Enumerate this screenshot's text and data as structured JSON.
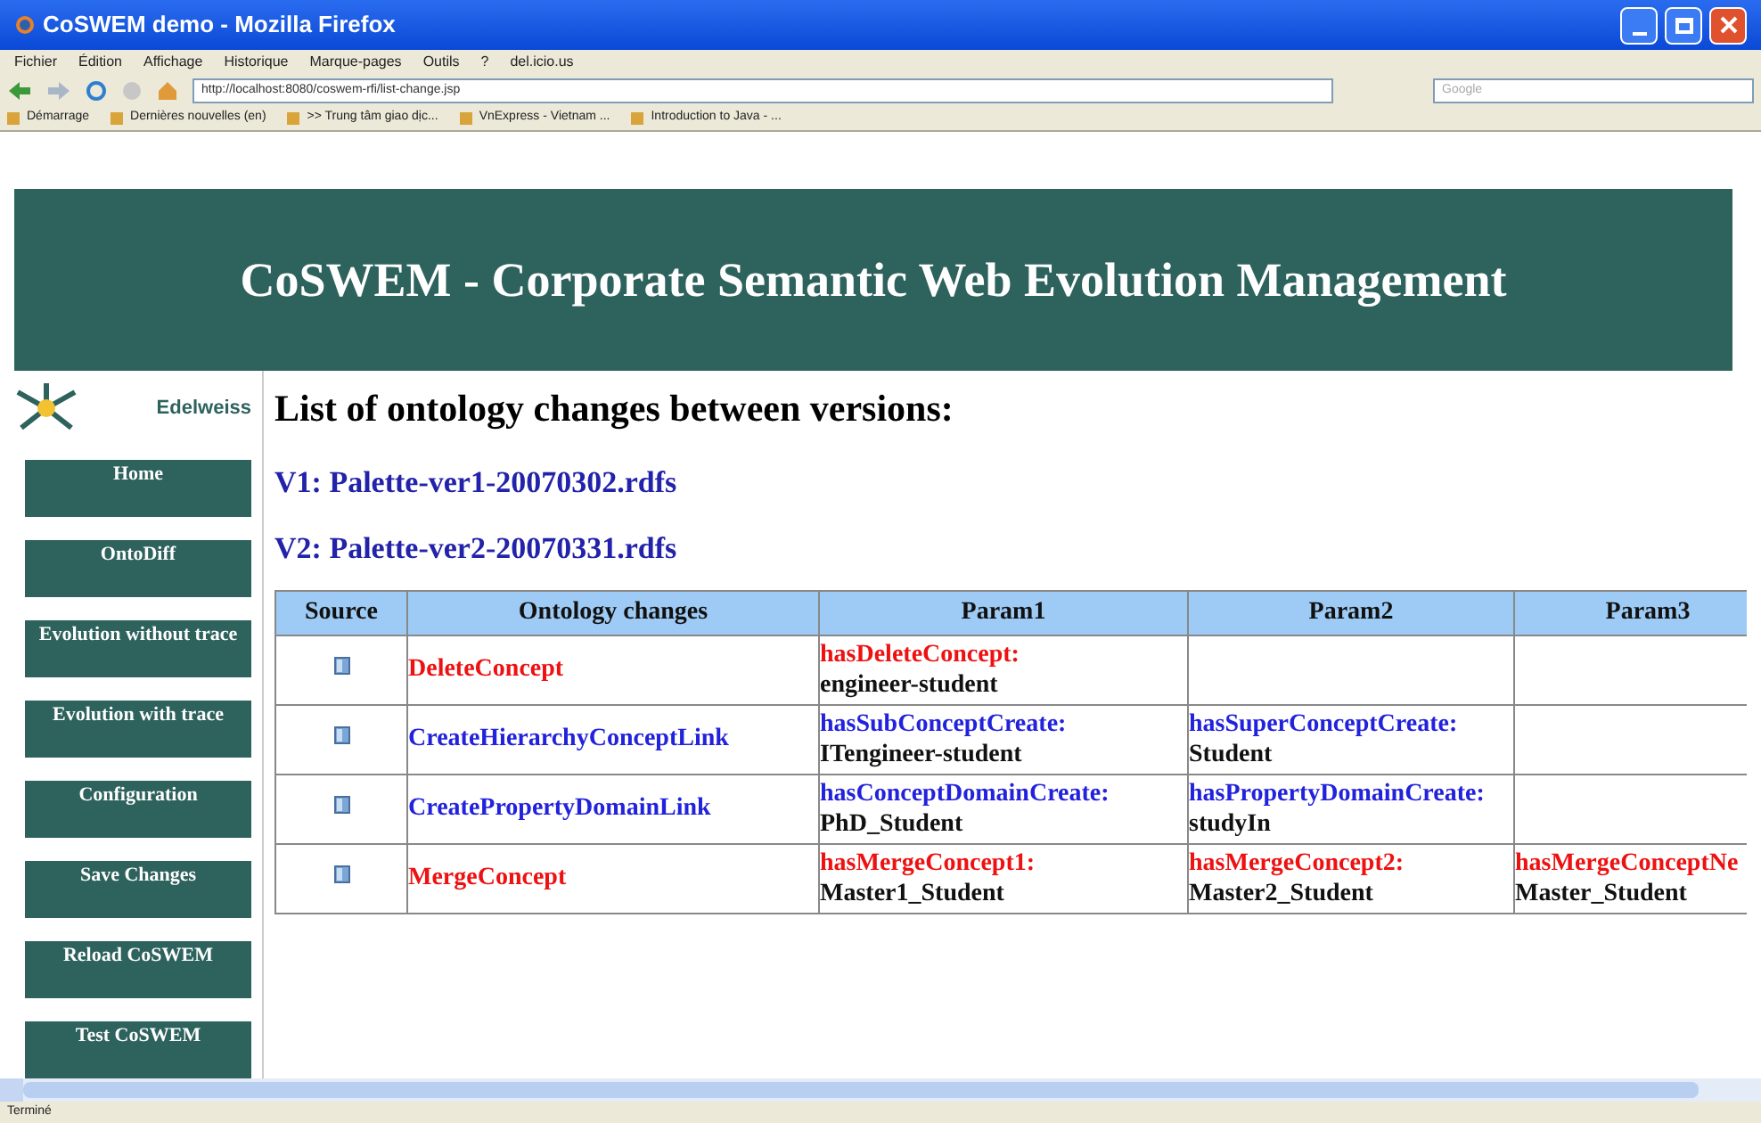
{
  "window": {
    "title": "CoSWEM demo - Mozilla Firefox"
  },
  "menu": [
    "Fichier",
    "Édition",
    "Affichage",
    "Historique",
    "Marque-pages",
    "Outils",
    "?",
    "del.icio.us"
  ],
  "address": {
    "value": "http://localhost:8080/coswem-rfi/list-change.jsp"
  },
  "search": {
    "placeholder": "Google"
  },
  "bookmarks": [
    "Démarrage",
    "Dernières nouvelles (en)",
    ">> Trung tâm giao dịc...",
    "VnExpress - Vietnam ...",
    "Introduction to Java - ..."
  ],
  "banner": {
    "title": "CoSWEM - Corporate Semantic Web Evolution Management"
  },
  "sidebar": {
    "logo_text": "Edelweiss",
    "items": [
      "Home",
      "OntoDiff",
      "Evolution without trace",
      "Evolution with trace",
      "Configuration",
      "Save Changes",
      "Reload CoSWEM",
      "Test CoSWEM"
    ]
  },
  "heading": "List of ontology changes between versions:",
  "versions": [
    "V1: Palette-ver1-20070302.rdfs",
    "V2: Palette-ver2-20070331.rdfs"
  ],
  "table": {
    "columns": [
      "Source",
      "Ontology changes",
      "Param1",
      "Param2",
      "Param3"
    ],
    "rows": [
      {
        "kind": "delete",
        "change": "DeleteConcept",
        "params": [
          {
            "label": "hasDeleteConcept:",
            "value": "engineer-student"
          }
        ]
      },
      {
        "kind": "create",
        "change": "CreateHierarchyConceptLink",
        "params": [
          {
            "label": "hasSubConceptCreate:",
            "value": "ITengineer-student"
          },
          {
            "label": "hasSuperConceptCreate:",
            "value": "Student"
          }
        ]
      },
      {
        "kind": "create",
        "change": "CreatePropertyDomainLink",
        "params": [
          {
            "label": "hasConceptDomainCreate:",
            "value": "PhD_Student"
          },
          {
            "label": "hasPropertyDomainCreate:",
            "value": "studyIn"
          }
        ]
      },
      {
        "kind": "merge",
        "change": "MergeConcept",
        "params": [
          {
            "label": "hasMergeConcept1:",
            "value": "Master1_Student"
          },
          {
            "label": "hasMergeConcept2:",
            "value": "Master2_Student"
          },
          {
            "label": "hasMergeConceptNe",
            "value": "Master_Student"
          }
        ]
      }
    ]
  },
  "status_bar": {
    "text": "Terminé"
  }
}
